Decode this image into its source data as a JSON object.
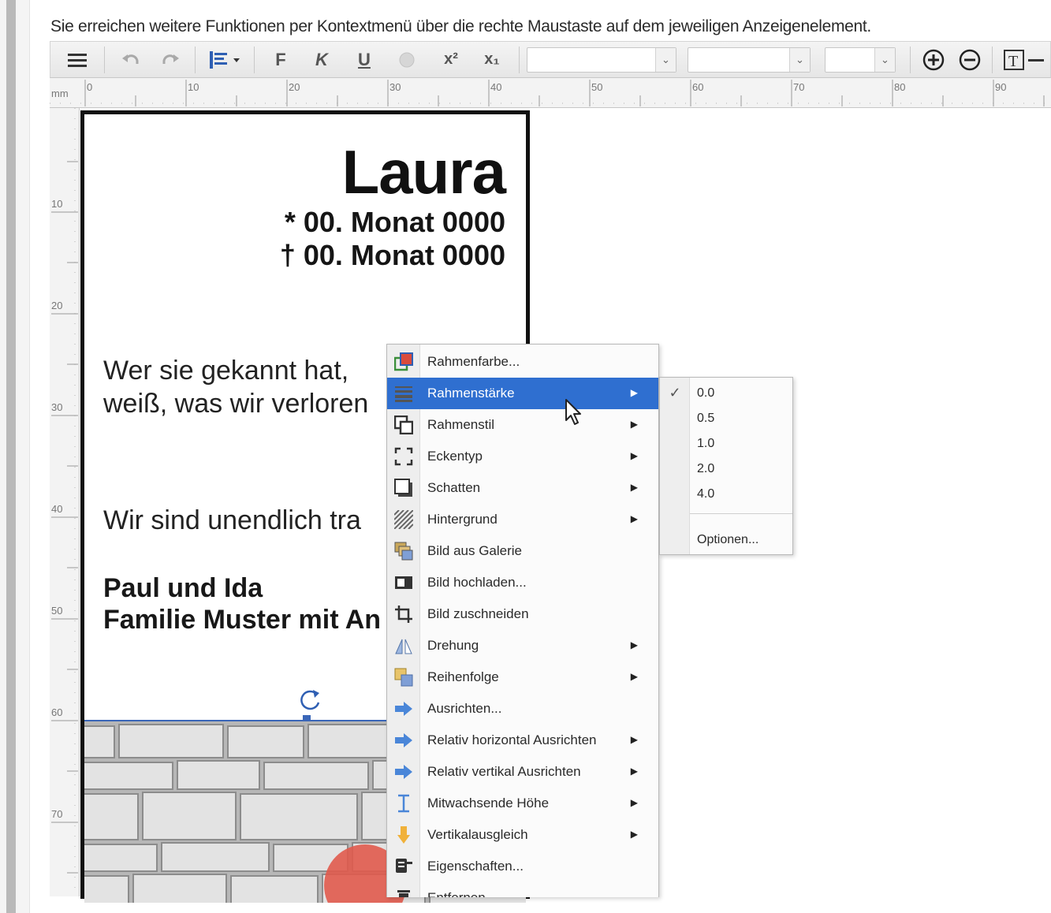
{
  "hint_text": "Sie erreichen weitere Funktionen per Kontextmenü über die rechte Maustaste auf dem jeweiligen Anzeigenelement.",
  "toolbar": {
    "bold_label": "F",
    "italic_label": "K",
    "underline_label": "U",
    "superscript_label": "x²",
    "subscript_label": "x₁",
    "font_select_value": "",
    "size_select_value": "",
    "lineheight_select_value": ""
  },
  "ruler": {
    "unit": "mm",
    "top_ticks": [
      "0",
      "10",
      "20",
      "30",
      "40",
      "50",
      "60",
      "70",
      "80",
      "90"
    ],
    "left_ticks": [
      "10",
      "20",
      "30",
      "40",
      "50",
      "60",
      "70"
    ]
  },
  "card": {
    "name": "Laura",
    "birth": "* 00. Monat 0000",
    "death": "† 00. Monat 0000",
    "verse_line1": "Wer sie gekannt hat,",
    "verse_line2": "weiß, was wir verloren",
    "verse_line3": "Wir sind unendlich tra",
    "signature_line1": "Paul und Ida",
    "signature_line2": "Familie Muster mit An"
  },
  "context_menu": {
    "items": [
      {
        "label": "Rahmenfarbe...",
        "icon": "border-color-icon",
        "submenu": false
      },
      {
        "label": "Rahmenstärke",
        "icon": "border-width-icon",
        "submenu": true
      },
      {
        "label": "Rahmenstil",
        "icon": "border-style-icon",
        "submenu": true
      },
      {
        "label": "Eckentyp",
        "icon": "corner-type-icon",
        "submenu": true
      },
      {
        "label": "Schatten",
        "icon": "shadow-icon",
        "submenu": true
      },
      {
        "label": "Hintergrund",
        "icon": "background-pattern-icon",
        "submenu": true
      },
      {
        "label": "Bild aus Galerie",
        "icon": "gallery-icon",
        "submenu": false
      },
      {
        "label": "Bild hochladen...",
        "icon": "upload-image-icon",
        "submenu": false
      },
      {
        "label": "Bild zuschneiden",
        "icon": "crop-icon",
        "submenu": false
      },
      {
        "label": "Drehung",
        "icon": "rotation-icon",
        "submenu": true
      },
      {
        "label": "Reihenfolge",
        "icon": "order-icon",
        "submenu": true
      },
      {
        "label": "Ausrichten...",
        "icon": "align-arrow-icon",
        "submenu": false
      },
      {
        "label": "Relativ horizontal Ausrichten",
        "icon": "align-arrow-icon",
        "submenu": true
      },
      {
        "label": "Relativ vertikal Ausrichten",
        "icon": "align-arrow-icon",
        "submenu": true
      },
      {
        "label": "Mitwachsende Höhe",
        "icon": "text-cursor-icon",
        "submenu": true
      },
      {
        "label": "Vertikalausgleich",
        "icon": "vertical-balance-icon",
        "submenu": true
      },
      {
        "label": "Eigenschaften...",
        "icon": "properties-icon",
        "submenu": false
      },
      {
        "label": "Entfernen",
        "icon": "trash-icon",
        "submenu": false
      }
    ],
    "active_index": 1
  },
  "submenu": {
    "options": [
      "0.0",
      "0.5",
      "1.0",
      "2.0",
      "4.0"
    ],
    "checked": "0.0",
    "footer": "Optionen..."
  },
  "colors": {
    "menu_highlight": "#2f6fd0",
    "selection_border": "#3a66b8",
    "frame": "#111111"
  }
}
